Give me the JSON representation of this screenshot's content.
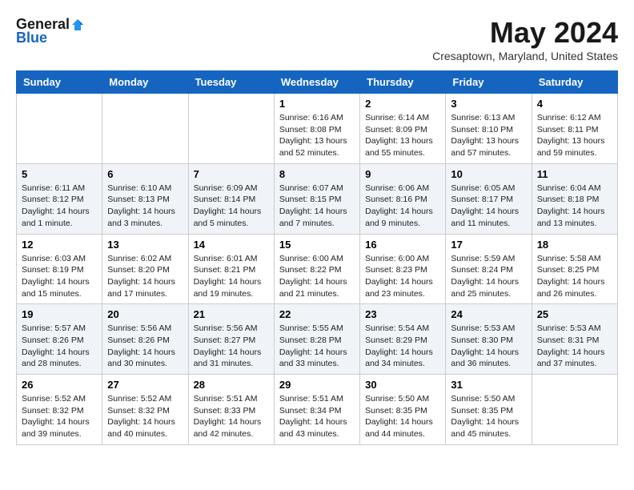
{
  "logo": {
    "general": "General",
    "blue": "Blue"
  },
  "title": "May 2024",
  "location": "Cresaptown, Maryland, United States",
  "weekdays": [
    "Sunday",
    "Monday",
    "Tuesday",
    "Wednesday",
    "Thursday",
    "Friday",
    "Saturday"
  ],
  "weeks": [
    [
      {
        "day": "",
        "info": ""
      },
      {
        "day": "",
        "info": ""
      },
      {
        "day": "",
        "info": ""
      },
      {
        "day": "1",
        "info": "Sunrise: 6:16 AM\nSunset: 8:08 PM\nDaylight: 13 hours and 52 minutes."
      },
      {
        "day": "2",
        "info": "Sunrise: 6:14 AM\nSunset: 8:09 PM\nDaylight: 13 hours and 55 minutes."
      },
      {
        "day": "3",
        "info": "Sunrise: 6:13 AM\nSunset: 8:10 PM\nDaylight: 13 hours and 57 minutes."
      },
      {
        "day": "4",
        "info": "Sunrise: 6:12 AM\nSunset: 8:11 PM\nDaylight: 13 hours and 59 minutes."
      }
    ],
    [
      {
        "day": "5",
        "info": "Sunrise: 6:11 AM\nSunset: 8:12 PM\nDaylight: 14 hours and 1 minute."
      },
      {
        "day": "6",
        "info": "Sunrise: 6:10 AM\nSunset: 8:13 PM\nDaylight: 14 hours and 3 minutes."
      },
      {
        "day": "7",
        "info": "Sunrise: 6:09 AM\nSunset: 8:14 PM\nDaylight: 14 hours and 5 minutes."
      },
      {
        "day": "8",
        "info": "Sunrise: 6:07 AM\nSunset: 8:15 PM\nDaylight: 14 hours and 7 minutes."
      },
      {
        "day": "9",
        "info": "Sunrise: 6:06 AM\nSunset: 8:16 PM\nDaylight: 14 hours and 9 minutes."
      },
      {
        "day": "10",
        "info": "Sunrise: 6:05 AM\nSunset: 8:17 PM\nDaylight: 14 hours and 11 minutes."
      },
      {
        "day": "11",
        "info": "Sunrise: 6:04 AM\nSunset: 8:18 PM\nDaylight: 14 hours and 13 minutes."
      }
    ],
    [
      {
        "day": "12",
        "info": "Sunrise: 6:03 AM\nSunset: 8:19 PM\nDaylight: 14 hours and 15 minutes."
      },
      {
        "day": "13",
        "info": "Sunrise: 6:02 AM\nSunset: 8:20 PM\nDaylight: 14 hours and 17 minutes."
      },
      {
        "day": "14",
        "info": "Sunrise: 6:01 AM\nSunset: 8:21 PM\nDaylight: 14 hours and 19 minutes."
      },
      {
        "day": "15",
        "info": "Sunrise: 6:00 AM\nSunset: 8:22 PM\nDaylight: 14 hours and 21 minutes."
      },
      {
        "day": "16",
        "info": "Sunrise: 6:00 AM\nSunset: 8:23 PM\nDaylight: 14 hours and 23 minutes."
      },
      {
        "day": "17",
        "info": "Sunrise: 5:59 AM\nSunset: 8:24 PM\nDaylight: 14 hours and 25 minutes."
      },
      {
        "day": "18",
        "info": "Sunrise: 5:58 AM\nSunset: 8:25 PM\nDaylight: 14 hours and 26 minutes."
      }
    ],
    [
      {
        "day": "19",
        "info": "Sunrise: 5:57 AM\nSunset: 8:26 PM\nDaylight: 14 hours and 28 minutes."
      },
      {
        "day": "20",
        "info": "Sunrise: 5:56 AM\nSunset: 8:26 PM\nDaylight: 14 hours and 30 minutes."
      },
      {
        "day": "21",
        "info": "Sunrise: 5:56 AM\nSunset: 8:27 PM\nDaylight: 14 hours and 31 minutes."
      },
      {
        "day": "22",
        "info": "Sunrise: 5:55 AM\nSunset: 8:28 PM\nDaylight: 14 hours and 33 minutes."
      },
      {
        "day": "23",
        "info": "Sunrise: 5:54 AM\nSunset: 8:29 PM\nDaylight: 14 hours and 34 minutes."
      },
      {
        "day": "24",
        "info": "Sunrise: 5:53 AM\nSunset: 8:30 PM\nDaylight: 14 hours and 36 minutes."
      },
      {
        "day": "25",
        "info": "Sunrise: 5:53 AM\nSunset: 8:31 PM\nDaylight: 14 hours and 37 minutes."
      }
    ],
    [
      {
        "day": "26",
        "info": "Sunrise: 5:52 AM\nSunset: 8:32 PM\nDaylight: 14 hours and 39 minutes."
      },
      {
        "day": "27",
        "info": "Sunrise: 5:52 AM\nSunset: 8:32 PM\nDaylight: 14 hours and 40 minutes."
      },
      {
        "day": "28",
        "info": "Sunrise: 5:51 AM\nSunset: 8:33 PM\nDaylight: 14 hours and 42 minutes."
      },
      {
        "day": "29",
        "info": "Sunrise: 5:51 AM\nSunset: 8:34 PM\nDaylight: 14 hours and 43 minutes."
      },
      {
        "day": "30",
        "info": "Sunrise: 5:50 AM\nSunset: 8:35 PM\nDaylight: 14 hours and 44 minutes."
      },
      {
        "day": "31",
        "info": "Sunrise: 5:50 AM\nSunset: 8:35 PM\nDaylight: 14 hours and 45 minutes."
      },
      {
        "day": "",
        "info": ""
      }
    ]
  ]
}
